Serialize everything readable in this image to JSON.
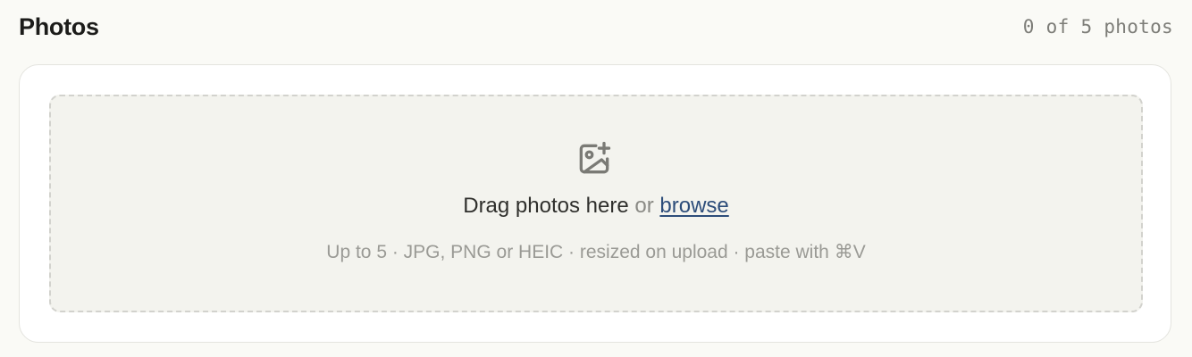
{
  "section": {
    "title": "Photos",
    "count_text": "0 of 5 photos"
  },
  "dropzone": {
    "icon": "image-add-icon",
    "drag_text": "Drag photos here",
    "or_text": "or",
    "browse_label": "browse",
    "hint": "Up to 5 · JPG, PNG or HEIC · resized on upload · paste with ⌘V"
  },
  "colors": {
    "link": "#2d4d7a",
    "page_background": "#fafaf6",
    "dropzone_background": "#f3f3ee"
  }
}
